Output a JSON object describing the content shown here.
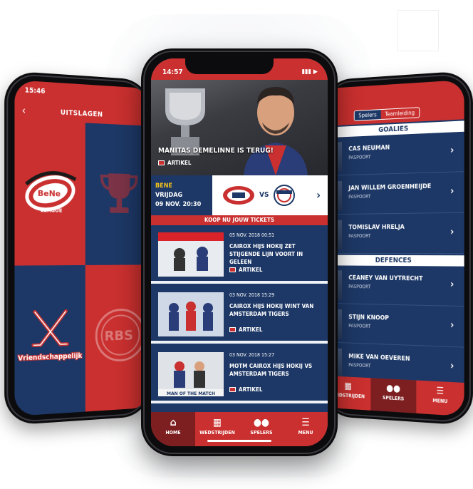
{
  "left_phone": {
    "time": "15:46",
    "title": "UITSLAGEN",
    "tiles": [
      {
        "label": "BeNe LEAGUE"
      },
      {
        "label": "Vriendschappelijk"
      },
      {
        "label": "RBS"
      }
    ]
  },
  "center_phone": {
    "time": "14:57",
    "hero": {
      "title": "MANITAS DEMELINNE IS TERUG!",
      "tag": "ARTIKEL"
    },
    "game": {
      "league": "BENE",
      "day": "VRIJDAG",
      "datetime": "09 NOV. 20:30",
      "vs": "VS"
    },
    "tickets_label": "KOOP NU JOUW TICKETS",
    "news": [
      {
        "date": "05 NOV. 2018 00:51",
        "title": "CAIROX HIJS HOKIJ ZET STIJGENDE LIJN VOORT IN GELEEN",
        "tag": "ARTIKEL"
      },
      {
        "date": "03 NOV. 2018 15:29",
        "title": "CAIROX HIJS HOKIJ WINT VAN AMSTERDAM TIGERS",
        "tag": "ARTIKEL"
      },
      {
        "date": "03 NOV. 2018 15:27",
        "title": "MOTM CAIROX HIJS HOKIJ VS AMSTERDAM TIGERS",
        "tag": "ARTIKEL",
        "img_caption": "MAN OF THE MATCH"
      }
    ],
    "tabs": [
      "HOME",
      "WEDSTRIJDEN",
      "SPELERS",
      "MENU"
    ]
  },
  "right_phone": {
    "segments": [
      "Spelers",
      "Teamleiding"
    ],
    "goalies_heading": "GOALIES",
    "goalies": [
      {
        "name": "CAS NEUMAN",
        "sub": "PASPOORT"
      },
      {
        "name": "JAN WILLEM GROENHEIJDE",
        "sub": "PASPOORT"
      },
      {
        "name": "TOMISLAV HRELJA",
        "sub": "PASPOORT"
      }
    ],
    "defences_heading": "DEFENCES",
    "defences": [
      {
        "name": "CEANEY VAN UYTRECHT",
        "sub": "PASPOORT"
      },
      {
        "name": "STIJN KNOOP",
        "sub": "PASPOORT"
      },
      {
        "name": "MIKE VAN OEVEREN",
        "sub": "PASPOORT"
      }
    ],
    "tabs": [
      "WEDSTRIJDEN",
      "SPELERS",
      "MENU"
    ]
  },
  "colors": {
    "brand_red": "#c9302f",
    "navy": "#1d3866",
    "dark_red": "#7d1f21",
    "gold": "#f3c31b"
  }
}
